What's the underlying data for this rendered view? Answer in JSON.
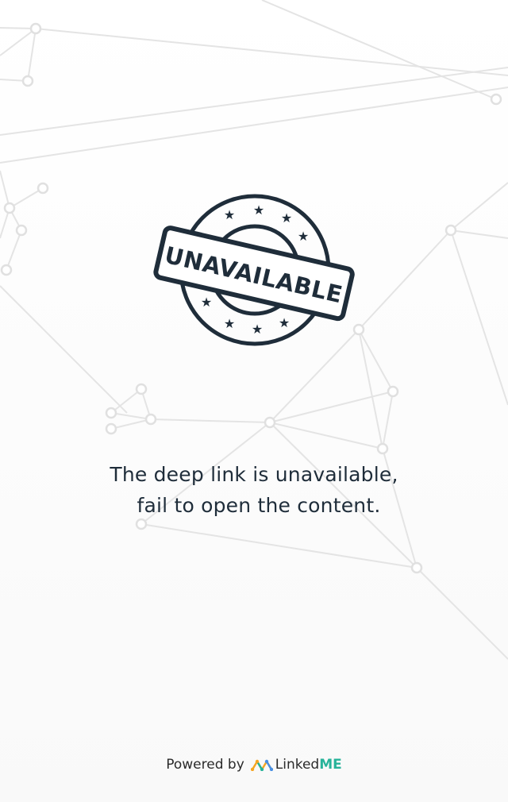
{
  "stamp": {
    "text": "UNAVAILABLE"
  },
  "message": {
    "line1": "The deep link is unavailable,",
    "line2": "fail to open the content."
  },
  "footer": {
    "powered_by": "Powered by",
    "brand_linked": "Linked",
    "brand_me": "ME"
  },
  "colors": {
    "stamp": "#1f2d3a",
    "text": "#1f2d3a",
    "brand_accent": "#27b39a",
    "network_lines": "#e6e6e6"
  }
}
